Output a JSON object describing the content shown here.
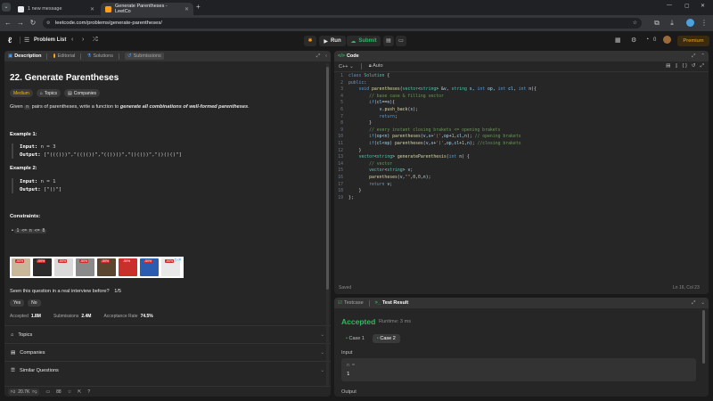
{
  "browser": {
    "tabs": [
      {
        "title": "1 new message",
        "fav_color": "#e8eaed"
      },
      {
        "title": "Generate Parentheses - LeetCo",
        "fav_color": "#ffa116"
      }
    ],
    "url": "leetcode.com/problems/generate-parentheses/"
  },
  "topbar": {
    "problem_list": "Problem List",
    "run_label": "Run",
    "submit_label": "Submit",
    "fire_count": "0",
    "premium_label": "Premium"
  },
  "description": {
    "tabs": [
      "Description",
      "Editorial",
      "Solutions",
      "Submissions"
    ],
    "title": "22. Generate Parentheses",
    "difficulty": "Medium",
    "topics_label": "Topics",
    "companies_label": "Companies",
    "statement_pre": "Given ",
    "statement_code": "n",
    "statement_mid": " pairs of parentheses, write a function to ",
    "statement_em": "generate all combinations of well-formed parentheses",
    "statement_post": ".",
    "example1": {
      "heading": "Example 1:",
      "input_label": "Input:",
      "input_value": "n = 3",
      "output_label": "Output:",
      "output_value": "[\"((()))\",\"(()())\",\"(())()\",\"()(())\",\"()()()\"]"
    },
    "example2": {
      "heading": "Example 2:",
      "input_label": "Input:",
      "input_value": "n = 1",
      "output_label": "Output:",
      "output_value": "[\"()\"]"
    },
    "constraints_heading": "Constraints:",
    "constraint_1": "1 <= n <= 8",
    "interview_q": "Seen this question in a real interview before?",
    "interview_count": "1/5",
    "yes_label": "Yes",
    "no_label": "No",
    "accepted_label": "Accepted",
    "accepted_value": "1.8M",
    "submissions_label": "Submissions",
    "submissions_value": "2.4M",
    "rate_label": "Acceptance Rate",
    "rate_value": "74.5%",
    "accordion": [
      "Topics",
      "Companies",
      "Similar Questions"
    ],
    "likes": "20.7K",
    "comments": "88",
    "ad_badges": [
      "-50%",
      "-50%",
      "-50%",
      "-50%",
      "-50%",
      "-50%",
      "-50%",
      "-50%"
    ]
  },
  "code_panel": {
    "title": "Code",
    "language": "C++",
    "auto_label": "Auto",
    "status_left": "Saved",
    "status_right": "Ln 16, Col 23",
    "lines": [
      [
        [
          "k",
          "class "
        ],
        [
          "t",
          "Solution "
        ],
        [
          "pl",
          "{"
        ]
      ],
      [
        [
          "k",
          "public"
        ],
        [
          "pl",
          ":"
        ]
      ],
      [
        [
          "pl",
          "    "
        ],
        [
          "k",
          "void "
        ],
        [
          "f",
          "parentheses"
        ],
        [
          "pl",
          "("
        ],
        [
          "t",
          "vector"
        ],
        [
          "pl",
          "<"
        ],
        [
          "t",
          "string"
        ],
        [
          "pl",
          "> &"
        ],
        [
          "v",
          "v"
        ],
        [
          "pl",
          ", "
        ],
        [
          "t",
          "string "
        ],
        [
          "v",
          "s"
        ],
        [
          "pl",
          ", "
        ],
        [
          "k",
          "int "
        ],
        [
          "v",
          "op"
        ],
        [
          "pl",
          ", "
        ],
        [
          "k",
          "int "
        ],
        [
          "v",
          "cl"
        ],
        [
          "pl",
          ", "
        ],
        [
          "k",
          "int "
        ],
        [
          "v",
          "n"
        ],
        [
          "pl",
          "){"
        ]
      ],
      [
        [
          "pl",
          "        "
        ],
        [
          "c",
          "// base case & filling vector"
        ]
      ],
      [
        [
          "pl",
          "        "
        ],
        [
          "k",
          "if"
        ],
        [
          "pl",
          "("
        ],
        [
          "v",
          "cl"
        ],
        [
          "pl",
          "=="
        ],
        [
          "v",
          "n"
        ],
        [
          "pl",
          "){"
        ]
      ],
      [
        [
          "pl",
          "            "
        ],
        [
          "v",
          "v"
        ],
        [
          "pl",
          "."
        ],
        [
          "f",
          "push_back"
        ],
        [
          "pl",
          "("
        ],
        [
          "v",
          "s"
        ],
        [
          "pl",
          ");"
        ]
      ],
      [
        [
          "pl",
          "            "
        ],
        [
          "k",
          "return"
        ],
        [
          "pl",
          ";"
        ]
      ],
      [
        [
          "pl",
          "        }"
        ]
      ],
      [
        [
          "pl",
          "        "
        ],
        [
          "c",
          "// every instant closing brakets <= opening brakets"
        ]
      ],
      [
        [
          "pl",
          "        "
        ],
        [
          "k",
          "if"
        ],
        [
          "pl",
          "("
        ],
        [
          "v",
          "op"
        ],
        [
          "pl",
          "<"
        ],
        [
          "v",
          "n"
        ],
        [
          "pl",
          ") "
        ],
        [
          "f",
          "parentheses"
        ],
        [
          "pl",
          "("
        ],
        [
          "v",
          "v"
        ],
        [
          "pl",
          ","
        ],
        [
          "v",
          "s"
        ],
        [
          "pl",
          "+"
        ],
        [
          "s",
          "'('"
        ],
        [
          "pl",
          ","
        ],
        [
          "v",
          "op"
        ],
        [
          "pl",
          "+"
        ],
        [
          "n",
          "1"
        ],
        [
          "pl",
          ","
        ],
        [
          "v",
          "cl"
        ],
        [
          "pl",
          ","
        ],
        [
          "v",
          "n"
        ],
        [
          "pl",
          "); "
        ],
        [
          "c",
          "// opening brakets"
        ]
      ],
      [
        [
          "pl",
          "        "
        ],
        [
          "k",
          "if"
        ],
        [
          "pl",
          "("
        ],
        [
          "v",
          "cl"
        ],
        [
          "pl",
          "<"
        ],
        [
          "v",
          "op"
        ],
        [
          "pl",
          ") "
        ],
        [
          "f",
          "parentheses"
        ],
        [
          "pl",
          "("
        ],
        [
          "v",
          "v"
        ],
        [
          "pl",
          ","
        ],
        [
          "v",
          "s"
        ],
        [
          "pl",
          "+"
        ],
        [
          "s",
          "')'"
        ],
        [
          "pl",
          ","
        ],
        [
          "v",
          "op"
        ],
        [
          "pl",
          ","
        ],
        [
          "v",
          "cl"
        ],
        [
          "pl",
          "+"
        ],
        [
          "n",
          "1"
        ],
        [
          "pl",
          ","
        ],
        [
          "v",
          "n"
        ],
        [
          "pl",
          "); "
        ],
        [
          "c",
          "//closing brakets"
        ]
      ],
      [
        [
          "pl",
          "    }"
        ]
      ],
      [
        [
          "pl",
          "    "
        ],
        [
          "t",
          "vector"
        ],
        [
          "pl",
          "<"
        ],
        [
          "t",
          "string"
        ],
        [
          "pl",
          "> "
        ],
        [
          "f",
          "generateParenthesis"
        ],
        [
          "pl",
          "("
        ],
        [
          "k",
          "int "
        ],
        [
          "v",
          "n"
        ],
        [
          "pl",
          ") {"
        ]
      ],
      [
        [
          "pl",
          "        "
        ],
        [
          "c",
          "// vector"
        ]
      ],
      [
        [
          "pl",
          "        "
        ],
        [
          "t",
          "vector"
        ],
        [
          "pl",
          "<"
        ],
        [
          "t",
          "string"
        ],
        [
          "pl",
          "> "
        ],
        [
          "v",
          "v"
        ],
        [
          "pl",
          ";"
        ]
      ],
      [
        [
          "pl",
          "        "
        ],
        [
          "f",
          "parentheses"
        ],
        [
          "pl",
          "("
        ],
        [
          "v",
          "v"
        ],
        [
          "pl",
          ","
        ],
        [
          "s",
          "\"\""
        ],
        [
          "pl",
          ","
        ],
        [
          "n",
          "0"
        ],
        [
          "pl",
          ","
        ],
        [
          "n",
          "0"
        ],
        [
          "pl",
          ","
        ],
        [
          "v",
          "n"
        ],
        [
          "pl",
          ");"
        ]
      ],
      [
        [
          "pl",
          "        "
        ],
        [
          "k",
          "return "
        ],
        [
          "v",
          "v"
        ],
        [
          "pl",
          ";"
        ]
      ],
      [
        [
          "pl",
          "    }"
        ]
      ],
      [
        [
          "pl",
          "};"
        ]
      ]
    ]
  },
  "test_panel": {
    "tab1": "Testcase",
    "tab2": "Test Result",
    "verdict": "Accepted",
    "runtime": "Runtime: 3 ms",
    "case1": "Case 1",
    "case2": "Case 2",
    "input_label": "Input",
    "input_var": "n =",
    "input_value": "1",
    "output_label": "Output"
  },
  "colors": {
    "accent": "#ffa116",
    "green": "#2cbb5d",
    "medium": "#ffb800"
  }
}
